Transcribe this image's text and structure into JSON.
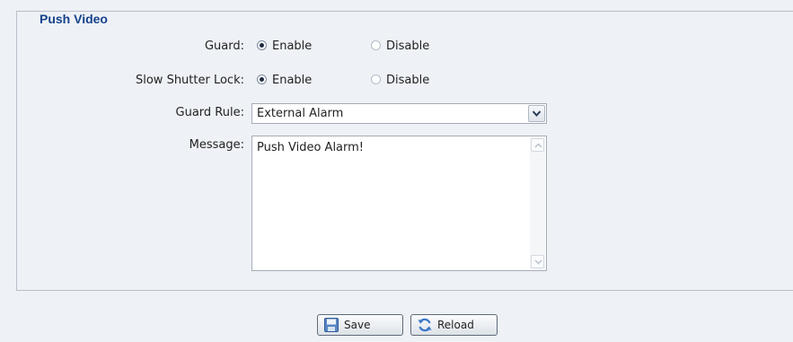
{
  "group": {
    "title": "Push Video"
  },
  "guard": {
    "label": "Guard:",
    "options": [
      {
        "label": "Enable",
        "selected": true
      },
      {
        "label": "Disable",
        "selected": false
      }
    ]
  },
  "slow_shutter": {
    "label": "Slow Shutter Lock:",
    "options": [
      {
        "label": "Enable",
        "selected": true
      },
      {
        "label": "Disable",
        "selected": false
      }
    ]
  },
  "guard_rule": {
    "label": "Guard Rule:",
    "value": "External Alarm"
  },
  "message": {
    "label": "Message:",
    "value": "Push Video Alarm!"
  },
  "buttons": {
    "save": "Save",
    "reload": "Reload"
  },
  "icons": {
    "dropdown": "chevron-down-icon",
    "scroll_up": "scroll-up-icon",
    "scroll_down": "scroll-down-icon",
    "save": "floppy-disk-icon",
    "reload": "reload-icon"
  }
}
